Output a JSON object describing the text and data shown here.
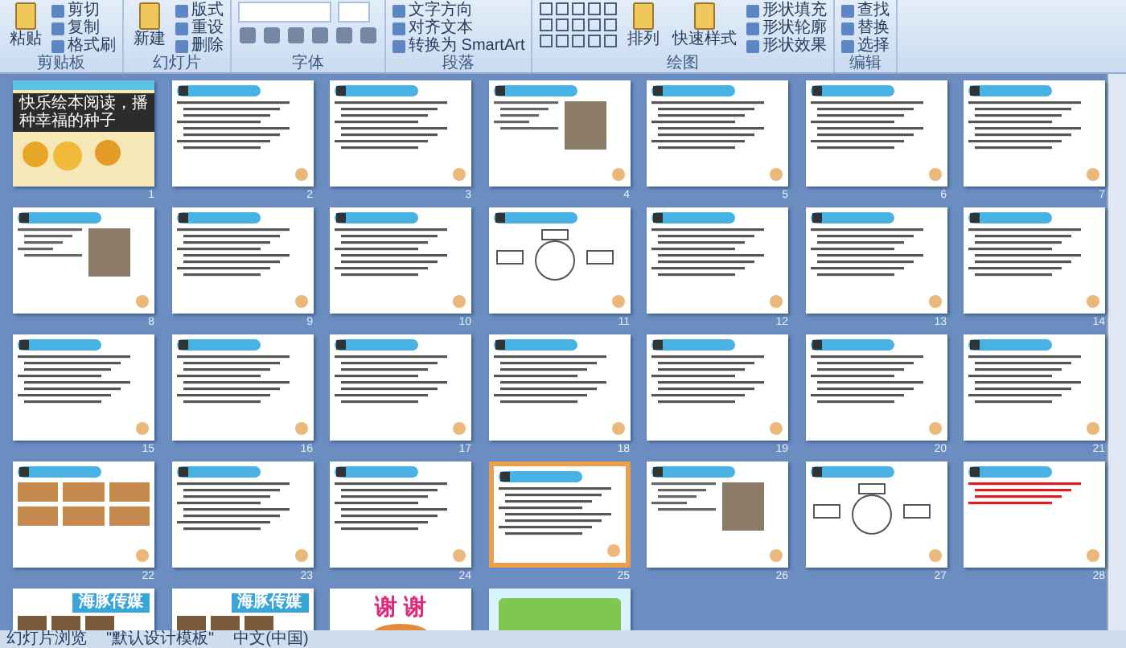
{
  "ribbon": {
    "groups": [
      {
        "label": "剪贴板",
        "big": [
          "粘贴"
        ],
        "small": [
          "剪切",
          "复制",
          "格式刷"
        ]
      },
      {
        "label": "幻灯片",
        "big": [
          "新建"
        ],
        "small": [
          "版式",
          "重设",
          "删除"
        ]
      },
      {
        "label": "字体"
      },
      {
        "label": "段落",
        "small": [
          "文字方向",
          "对齐文本",
          "转换为 SmartArt"
        ]
      },
      {
        "label": "绘图",
        "big": [
          "排列",
          "快速样式"
        ],
        "small": [
          "形状填充",
          "形状轮廓",
          "形状效果"
        ]
      },
      {
        "label": "编辑",
        "small": [
          "查找",
          "替换",
          "选择"
        ]
      }
    ]
  },
  "slides": [
    {
      "number": "1",
      "kind": "cover",
      "title": "快乐绘本阅读，播种幸福的种子",
      "selected": false
    },
    {
      "number": "2",
      "kind": "text",
      "selected": false
    },
    {
      "number": "3",
      "kind": "text",
      "selected": false
    },
    {
      "number": "4",
      "kind": "portrait",
      "selected": false
    },
    {
      "number": "5",
      "kind": "text",
      "selected": false
    },
    {
      "number": "6",
      "kind": "text",
      "selected": false
    },
    {
      "number": "7",
      "kind": "text",
      "selected": false
    },
    {
      "number": "8",
      "kind": "book",
      "selected": false
    },
    {
      "number": "9",
      "kind": "text",
      "selected": false
    },
    {
      "number": "10",
      "kind": "text",
      "selected": false
    },
    {
      "number": "11",
      "kind": "diagram",
      "selected": false
    },
    {
      "number": "12",
      "kind": "text",
      "selected": false
    },
    {
      "number": "13",
      "kind": "text",
      "selected": false
    },
    {
      "number": "14",
      "kind": "text",
      "selected": false
    },
    {
      "number": "15",
      "kind": "text",
      "selected": false
    },
    {
      "number": "16",
      "kind": "text",
      "selected": false
    },
    {
      "number": "17",
      "kind": "text",
      "selected": false
    },
    {
      "number": "18",
      "kind": "text",
      "selected": false
    },
    {
      "number": "19",
      "kind": "text",
      "selected": false
    },
    {
      "number": "20",
      "kind": "text",
      "selected": false
    },
    {
      "number": "21",
      "kind": "text",
      "selected": false
    },
    {
      "number": "22",
      "kind": "books",
      "selected": false
    },
    {
      "number": "23",
      "kind": "text",
      "selected": false
    },
    {
      "number": "24",
      "kind": "text",
      "selected": false
    },
    {
      "number": "25",
      "kind": "text",
      "selected": true
    },
    {
      "number": "26",
      "kind": "portrait",
      "selected": false
    },
    {
      "number": "27",
      "kind": "diagram",
      "selected": false
    },
    {
      "number": "28",
      "kind": "redtext",
      "selected": false
    },
    {
      "kind": "brand",
      "title": "海豚传媒",
      "selected": false
    },
    {
      "kind": "brand",
      "title": "海豚传媒",
      "selected": false
    },
    {
      "kind": "thanks",
      "title": "谢 谢",
      "selected": false
    },
    {
      "kind": "green",
      "selected": false
    }
  ],
  "status_bar": [
    "幻灯片浏览",
    "\"默认设计模板\"",
    "中文(中国)"
  ]
}
